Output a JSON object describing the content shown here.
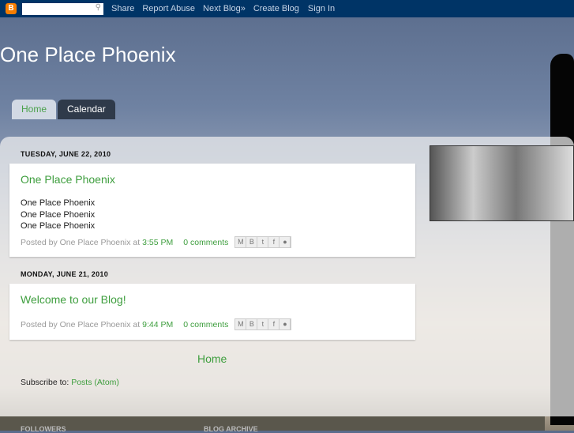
{
  "navbar": {
    "logo": "B",
    "share": "Share",
    "report": "Report Abuse",
    "next": "Next Blog»",
    "create": "Create Blog",
    "signin": "Sign In"
  },
  "blog_title": "One Place Phoenix",
  "tabs": [
    {
      "label": "Home"
    },
    {
      "label": "Calendar"
    }
  ],
  "posts": [
    {
      "date": "TUESDAY, JUNE 22, 2010",
      "title": "One Place Phoenix",
      "body": [
        "One Place Phoenix",
        "One Place Phoenix",
        "One Place Phoenix"
      ],
      "posted_by": "Posted by One Place Phoenix at",
      "time": "3:55 PM",
      "comments": "0 comments"
    },
    {
      "date": "MONDAY, JUNE 21, 2010",
      "title": "Welcome to our Blog!",
      "posted_by": "Posted by One Place Phoenix at",
      "time": "9:44 PM",
      "comments": "0 comments"
    }
  ],
  "home_link": "Home",
  "subscribe": {
    "label": "Subscribe to:",
    "link": "Posts (Atom)"
  },
  "footer": {
    "followers": "FOLLOWERS",
    "archive": "BLOG ARCHIVE"
  }
}
